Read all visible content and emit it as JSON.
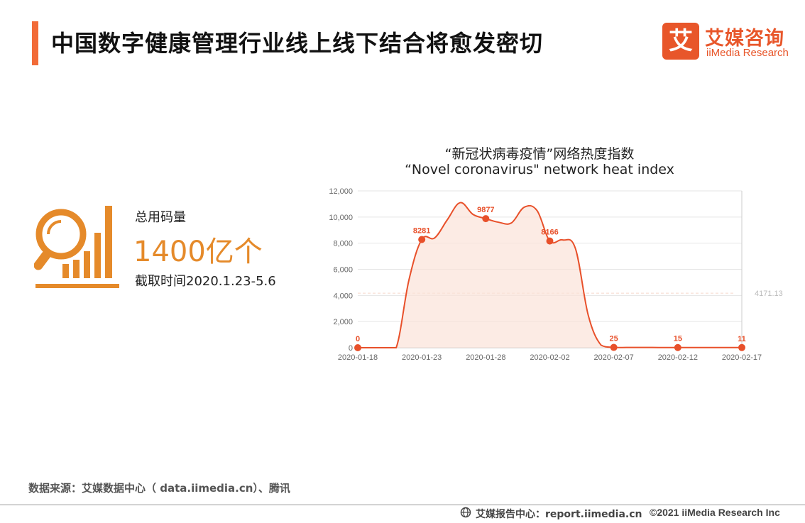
{
  "header": {
    "title": "中国数字健康管理行业线上线下结合将愈发密切",
    "logo_mark": "艾",
    "logo_cn": "艾媒咨询",
    "logo_en": "iiMedia Research"
  },
  "stat": {
    "label": "总用码量",
    "value": "1400亿个",
    "time": "截取时间2020.1.23-5.6",
    "icon": "magnifier-bar-chart-icon"
  },
  "chart_data": {
    "type": "area",
    "title": "“新冠状病毒疫情”网络热度指数",
    "subtitle": "“Novel coronavirus\" network heat index",
    "x_ticks": [
      "2020-01-18",
      "2020-01-23",
      "2020-01-28",
      "2020-02-02",
      "2020-02-07",
      "2020-02-12",
      "2020-02-17"
    ],
    "y_ticks": [
      "0",
      "2,000",
      "4,000",
      "6,000",
      "8,000",
      "10,000",
      "12,000"
    ],
    "ylim": [
      0,
      12000
    ],
    "series": [
      {
        "x": [
          "2020-01-18",
          "2020-01-19",
          "2020-01-20",
          "2020-01-21",
          "2020-01-22",
          "2020-01-23",
          "2020-01-24",
          "2020-01-25",
          "2020-01-26",
          "2020-01-27",
          "2020-01-28",
          "2020-01-29",
          "2020-01-30",
          "2020-01-31",
          "2020-02-01",
          "2020-02-02",
          "2020-02-03",
          "2020-02-04",
          "2020-02-05",
          "2020-02-06",
          "2020-02-07",
          "2020-02-08",
          "2020-02-09",
          "2020-02-10",
          "2020-02-11",
          "2020-02-12",
          "2020-02-13",
          "2020-02-14",
          "2020-02-15",
          "2020-02-16",
          "2020-02-17"
        ],
        "y": [
          0,
          0,
          0,
          0,
          5200,
          8281,
          8400,
          9800,
          11100,
          10200,
          9877,
          9600,
          9550,
          10750,
          10500,
          8166,
          8250,
          7600,
          2500,
          200,
          25,
          20,
          20,
          18,
          15,
          15,
          14,
          13,
          12,
          11,
          11
        ]
      }
    ],
    "point_labels": [
      {
        "x": "2020-01-18",
        "y": 0,
        "label": "0"
      },
      {
        "x": "2020-01-23",
        "y": 8281,
        "label": "8281"
      },
      {
        "x": "2020-01-28",
        "y": 9877,
        "label": "9877"
      },
      {
        "x": "2020-02-02",
        "y": 8166,
        "label": "8166"
      },
      {
        "x": "2020-02-07",
        "y": 25,
        "label": "25"
      },
      {
        "x": "2020-02-12",
        "y": 15,
        "label": "15"
      },
      {
        "x": "2020-02-17",
        "y": 11,
        "label": "11"
      }
    ],
    "reference_line": {
      "y": 4171.13,
      "label": "4171.13"
    },
    "grid": true,
    "colors": {
      "line": "#e8502a",
      "fill": "#fbe3d9",
      "grid": "#e5e5e5",
      "axis_text": "#666666",
      "reference": "#f6d6cb"
    }
  },
  "source": "数据来源：艾媒数据中心（ data.iimedia.cn）、腾讯",
  "footer": {
    "icon": "globe-icon",
    "text": "艾媒报告中心：report.iimedia.cn",
    "copyright": "©2021  iiMedia Research  Inc"
  }
}
